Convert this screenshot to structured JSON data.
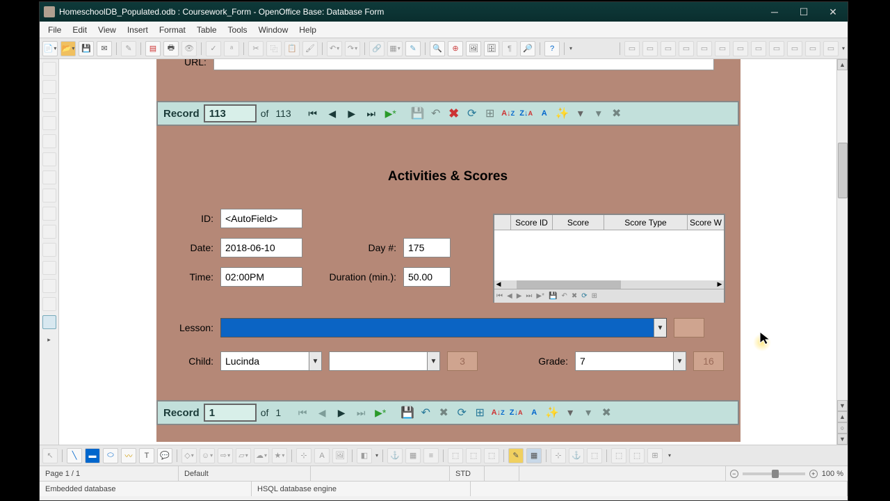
{
  "window": {
    "title": "HomeschoolDB_Populated.odb : Coursework_Form - OpenOffice Base: Database Form"
  },
  "menu": [
    "File",
    "Edit",
    "View",
    "Insert",
    "Format",
    "Table",
    "Tools",
    "Window",
    "Help"
  ],
  "url_label": "URL:",
  "url_value": "",
  "record_bar1": {
    "label": "Record",
    "current": "113",
    "of": "of",
    "total": "113"
  },
  "section_title": "Activities & Scores",
  "fields": {
    "id_label": "ID:",
    "id_value": "<AutoField>",
    "date_label": "Date:",
    "date_value": "2018-06-10",
    "day_label": "Day #:",
    "day_value": "175",
    "time_label": "Time:",
    "time_value": "02:00PM",
    "duration_label": "Duration (min.):",
    "duration_value": "50.00",
    "lesson_label": "Lesson:",
    "lesson_value": "",
    "child_label": "Child:",
    "child_value": "Lucinda",
    "blank_combo": "",
    "readonly1": "3",
    "grade_label": "Grade:",
    "grade_value": "7",
    "readonly2": "16"
  },
  "score_table": {
    "headers": [
      "Score ID",
      "Score",
      "Score Type",
      "Score W"
    ]
  },
  "record_bar2": {
    "label": "Record",
    "current": "1",
    "of": "of",
    "total": "1"
  },
  "status": {
    "page": "Page 1 / 1",
    "style": "Default",
    "mode": "STD",
    "zoom": "100 %",
    "db_type": "Embedded database",
    "db_engine": "HSQL database engine"
  }
}
